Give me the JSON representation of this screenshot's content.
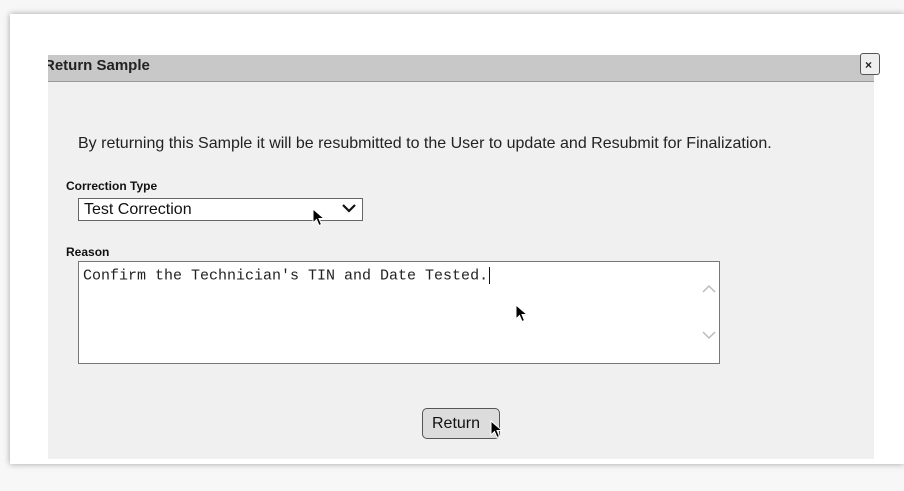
{
  "dialog": {
    "title": "Return Sample",
    "close_label": "×"
  },
  "message": "By returning this Sample it will be resubmitted to the User to update and Resubmit for Finalization.",
  "correction_type": {
    "label": "Correction Type",
    "selected_value": "Test Correction"
  },
  "reason": {
    "label": "Reason",
    "value": "Confirm the Technician's TIN and Date Tested."
  },
  "buttons": {
    "return_label": "Return"
  },
  "icons": {
    "dropdown": "chevron-down-icon",
    "scroll_up": "chevron-up-icon",
    "scroll_down": "chevron-down-icon",
    "cursor": "mouse-pointer-icon"
  }
}
